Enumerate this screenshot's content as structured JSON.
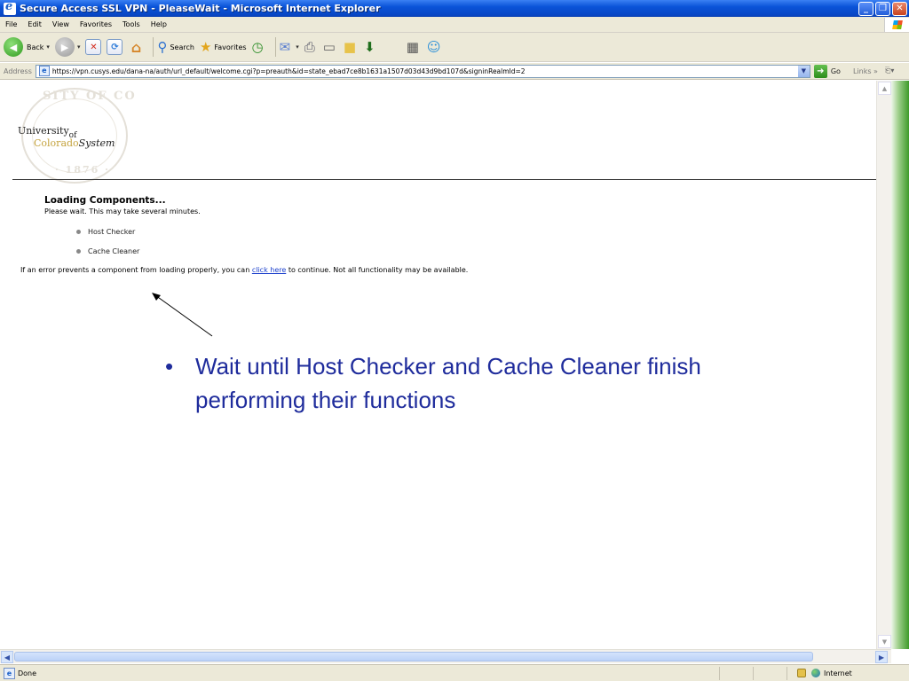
{
  "window": {
    "title": "Secure Access SSL VPN - PleaseWait - Microsoft Internet Explorer",
    "minimize": "_",
    "restore": "❐",
    "close": "✕"
  },
  "menu": [
    "File",
    "Edit",
    "View",
    "Favorites",
    "Tools",
    "Help"
  ],
  "toolbar": {
    "back_label": "Back",
    "search_label": "Search",
    "favorites_label": "Favorites"
  },
  "address": {
    "label": "Address",
    "url": "https://vpn.cusys.edu/dana-na/auth/url_default/welcome.cgi?p=preauth&id=state_ebad7ce8b1631a1507d03d43d9bd107d&signinRealmId=2",
    "go_label": "Go",
    "links_label": "Links »"
  },
  "logo": {
    "university": "University",
    "of": "of",
    "colorado": "Colorado",
    "system": "System",
    "seal_top": "SITY OF CO",
    "seal_year": "· 1876 ·"
  },
  "page": {
    "heading": "Loading Components...",
    "subtext": "Please wait. This may take several minutes.",
    "components": [
      "Host Checker",
      "Cache Cleaner"
    ],
    "error_prefix": "If an error prevents a component from loading properly, you can ",
    "error_link": "click here",
    "error_suffix": " to continue. Not all functionality may be available."
  },
  "annotation": {
    "bullet": "•",
    "text": "Wait until Host Checker and Cache Cleaner finish performing their functions",
    "color": "#1f2c9c"
  },
  "status": {
    "text": "Done",
    "zone": "Internet"
  },
  "colors": {
    "titlebar": "#0a53d8",
    "chrome": "#ece9d8",
    "link": "#1a3fcc"
  }
}
